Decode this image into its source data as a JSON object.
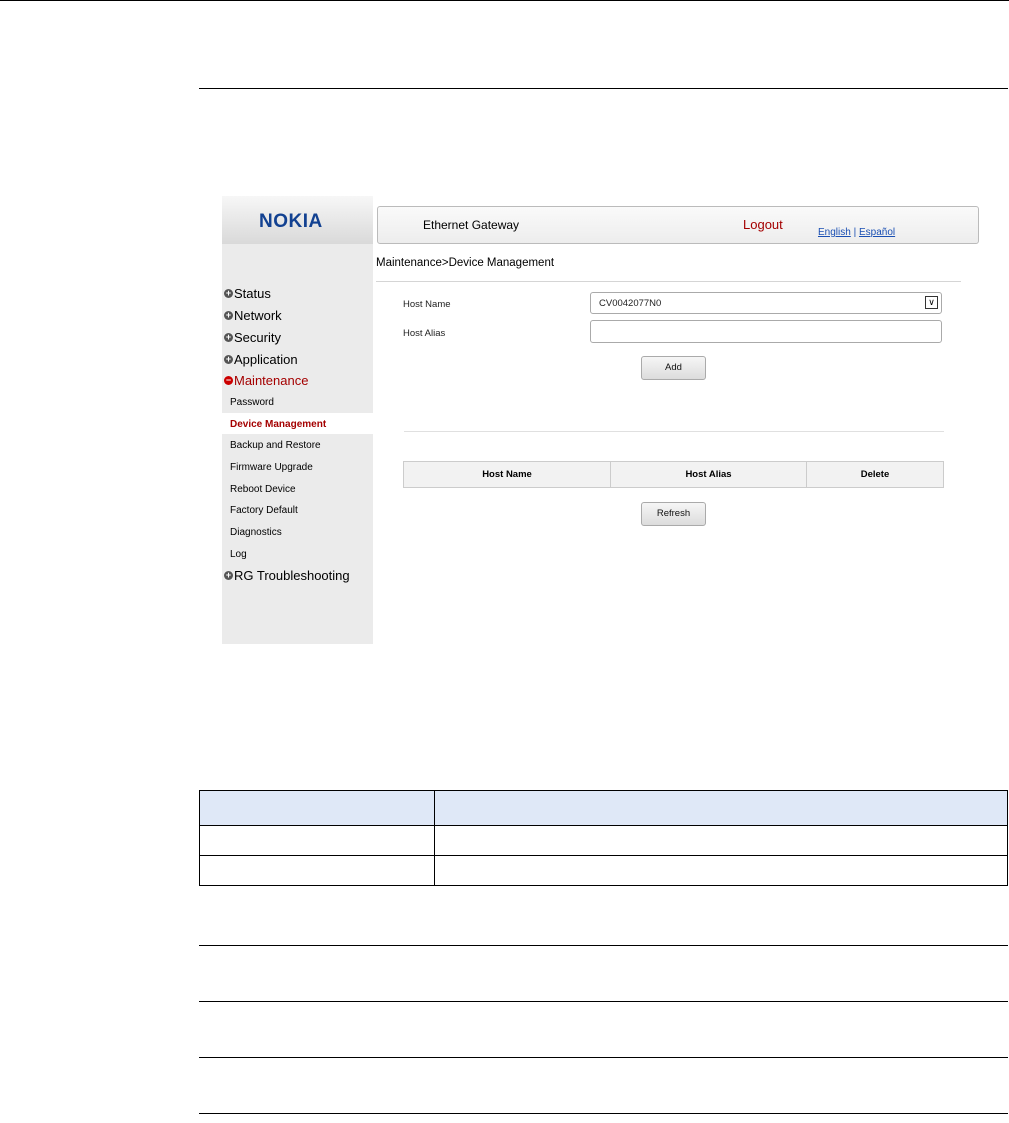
{
  "brand": "NOKIA",
  "header": {
    "product": "Ethernet Gateway",
    "logout": "Logout",
    "lang_english": "English",
    "lang_sep": "|",
    "lang_spanish": "Español"
  },
  "breadcrumb": "Maintenance>Device Management",
  "nav": {
    "status": "Status",
    "network": "Network",
    "security": "Security",
    "application": "Application",
    "maintenance": "Maintenance",
    "rg_troubleshooting": "RG Troubleshooting",
    "sub": [
      "Password",
      "Device Management",
      "Backup and Restore",
      "Firmware Upgrade",
      "Reboot Device",
      "Factory Default",
      "Diagnostics",
      "Log"
    ]
  },
  "form": {
    "host_name_label": "Host Name",
    "host_name_value": "CV0042077N0",
    "host_alias_label": "Host Alias",
    "host_alias_value": "",
    "add_button": "Add",
    "refresh_button": "Refresh"
  },
  "table": {
    "columns": [
      "Host Name",
      "Host Alias",
      "Delete"
    ]
  },
  "colors": {
    "brand_blue": "#124191",
    "accent_red": "#a40000",
    "doc_table_header": "#dfe8f7"
  }
}
